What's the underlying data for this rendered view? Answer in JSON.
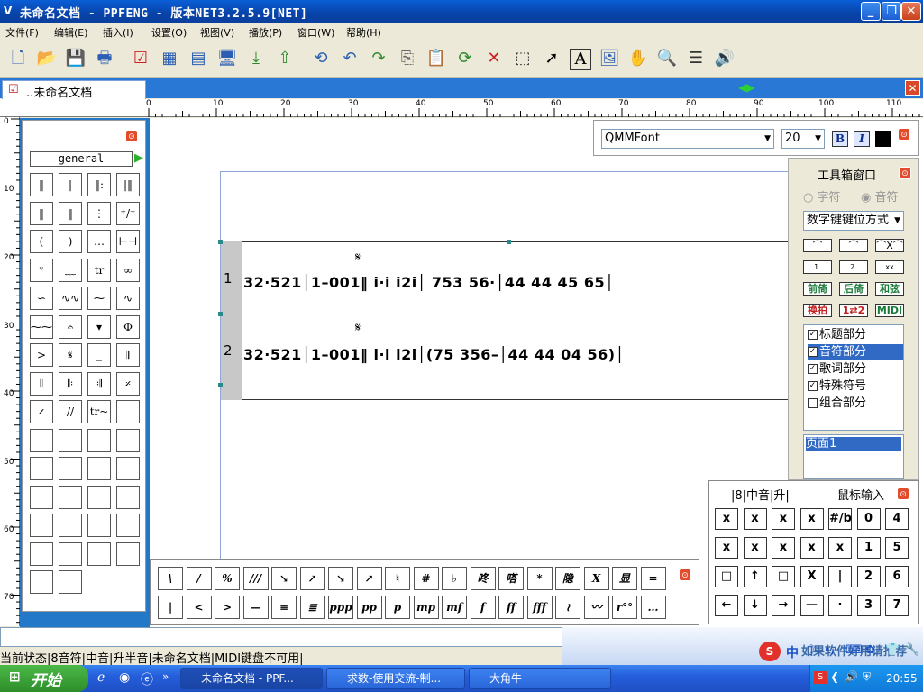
{
  "window": {
    "title": "未命名文档 - PPFENG - 版本NET3.2.5.9[NET]",
    "min": "_",
    "max": "❐",
    "close": "✕"
  },
  "menu": [
    "文件(F)",
    "编辑(E)",
    "插入(I)",
    "设置(O)",
    "视图(V)",
    "播放(P)",
    "窗口(W)",
    "帮助(H)"
  ],
  "toolbar_icons": [
    "new-icon",
    "open-icon",
    "save-icon",
    "print-icon",
    "check-icon",
    "grid-icon",
    "layout-icon",
    "monitor-icon",
    "download-icon",
    "upload-icon",
    "transform-icon",
    "undo-icon",
    "redo-icon",
    "copy-icon",
    "paste-icon",
    "refresh-icon",
    "delete-icon",
    "select-rect-icon",
    "pointer-icon",
    "text-icon",
    "image-icon",
    "hand-icon",
    "zoom-icon",
    "list-icon",
    "speaker-icon"
  ],
  "document_tab": {
    "label": "..未命名文档"
  },
  "ruler": {
    "top_labels": [
      "0",
      "10",
      "20",
      "30",
      "40",
      "50",
      "60",
      "70",
      "80",
      "90",
      "100",
      "110"
    ],
    "left_labels": [
      "0",
      "10",
      "20",
      "30",
      "40",
      "50",
      "60",
      "70"
    ]
  },
  "left_palette": {
    "selector": "general",
    "cells": [
      "‖",
      "|",
      "‖:",
      "|‖",
      "‖",
      "‖",
      "⋮",
      "⁺/⁻",
      "(",
      ")",
      "…",
      "⊢⊣",
      "ᵛ",
      "﹏",
      "tr",
      "∞",
      "∽",
      "∿∿",
      "⁓",
      "∿",
      "⁓⁓",
      "𝄐",
      "▾",
      "Φ",
      ">",
      "𝄋",
      "_",
      "𝄂",
      "𝄃",
      "𝄆",
      "𝄇",
      "𝄎",
      "𝄍",
      "//",
      "tr~",
      "",
      "",
      "",
      "",
      "",
      "",
      "",
      "",
      "",
      "",
      "",
      "",
      "",
      "",
      "",
      "",
      "",
      "",
      "",
      "",
      "",
      "",
      ""
    ]
  },
  "font_bar": {
    "font": "QMMFont",
    "size": "20",
    "bold": "B",
    "italic": "I"
  },
  "score": {
    "rows": [
      {
        "num": "1",
        "text": "32·521│1–001‖ i·i i2i│ 753 56·│44 44 45 65│",
        "segno": "𝄋"
      },
      {
        "num": "2",
        "text": "32·521│1–001‖ i·i i2i│(75 356–│44 44 04 56)│",
        "segno": "𝄋"
      }
    ]
  },
  "toolbox": {
    "title": "工具箱窗口",
    "radio_char": "字符",
    "radio_note": "音符",
    "dropdown": "数字键键位方式",
    "buttons_row1": [
      "⌒",
      "⌒",
      "⌒X⌒"
    ],
    "buttons_row2": [
      "1.",
      "2.",
      "xx"
    ],
    "buttons_row3": [
      "前倚",
      "后倚",
      "和弦"
    ],
    "buttons_row4": [
      "换拍",
      "1⇄2",
      "MIDI"
    ],
    "checks": [
      {
        "label": "标题部分",
        "checked": "✓"
      },
      {
        "label": "音符部分",
        "checked": "✓"
      },
      {
        "label": "歌词部分",
        "checked": "✓"
      },
      {
        "label": "特殊符号",
        "checked": "✓"
      },
      {
        "label": "组合部分",
        "checked": ""
      }
    ],
    "page_item": "页面1"
  },
  "keypad": {
    "status": "|8|中音|升|",
    "mode": "鼠标输入",
    "keys": [
      "x",
      "x",
      "x",
      "x",
      "#/b",
      "0",
      "4",
      "x",
      "x",
      "x",
      "x",
      "x",
      "1",
      "5",
      "□",
      "↑",
      "□",
      "X",
      "|",
      "2",
      "6",
      "←",
      "↓",
      "→",
      "—",
      "·",
      "3",
      "7"
    ]
  },
  "bottom_palette": {
    "row1": [
      "\\",
      "/",
      "%",
      "///",
      "↘",
      "↗",
      "↘",
      "↗",
      "♮",
      "#",
      "♭",
      "咚",
      "嗒",
      "*",
      "隐",
      "X",
      "显",
      "="
    ],
    "row2": [
      "|",
      "<",
      ">",
      "—",
      "≡",
      "≣",
      "ppp",
      "pp",
      "p",
      "mp",
      "mf",
      "f",
      "ff",
      "fff",
      "≀",
      "〰",
      "r°°",
      "…"
    ]
  },
  "status": "当前状态|8音符|中音|升半音|未命名文档|MIDI键盘不可用|",
  "ad": "如果软件好用请推荐",
  "taskbar": {
    "start": "开始",
    "tasks": [
      "未命名文档 - PPF...",
      "求数-使用交流-制...",
      "大角牛"
    ],
    "time": "20:55"
  },
  "ime": "中"
}
